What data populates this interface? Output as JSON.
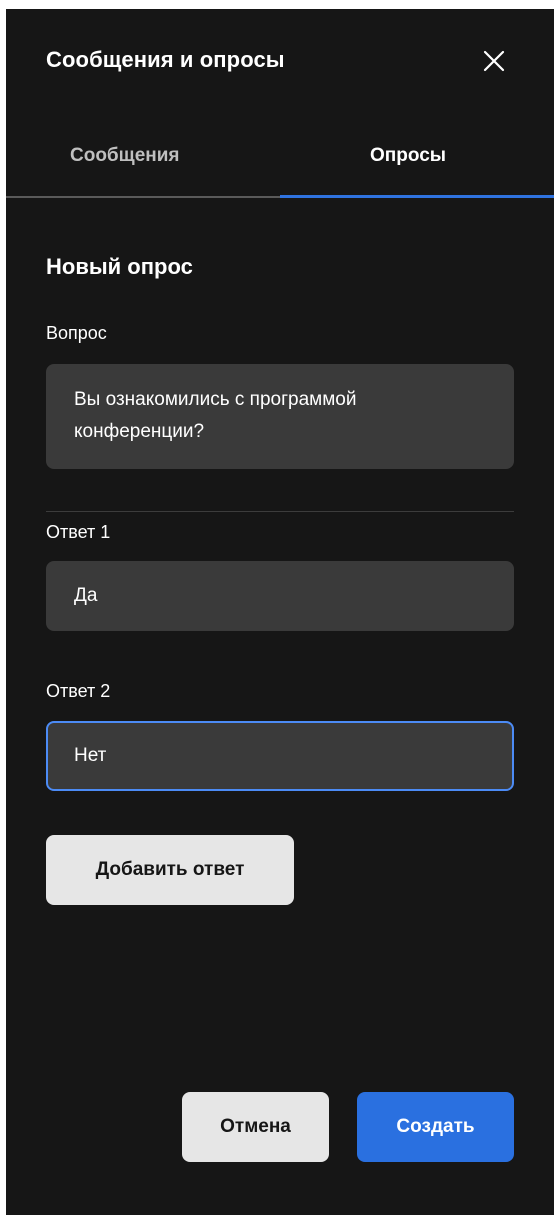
{
  "colors": {
    "panel_background": "#161616",
    "field_background": "#3a3a3a",
    "accent": "#2a70e0",
    "focus_border": "#4c8bf5",
    "secondary_button": "#e6e6e6"
  },
  "header": {
    "title": "Сообщения и опросы",
    "close_icon": "close-icon"
  },
  "tabs": [
    {
      "label": "Сообщения",
      "active": false
    },
    {
      "label": "Опросы",
      "active": true
    }
  ],
  "poll_form": {
    "section_title": "Новый опрос",
    "question": {
      "label": "Вопрос",
      "value": "Вы ознакомились с программой конференции?"
    },
    "answers": [
      {
        "label": "Ответ 1",
        "value": "Да",
        "focused": false
      },
      {
        "label": "Ответ 2",
        "value": "Нет",
        "focused": true
      }
    ],
    "add_answer_label": "Добавить ответ"
  },
  "footer": {
    "cancel_label": "Отмена",
    "create_label": "Создать"
  }
}
